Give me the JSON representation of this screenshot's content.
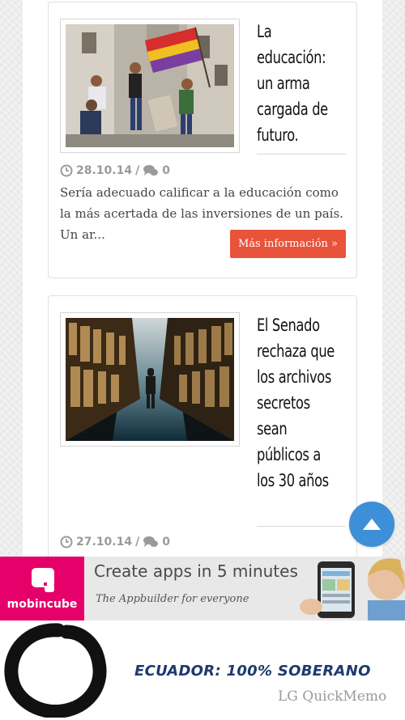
{
  "articles": [
    {
      "title": "La educación: un arma cargada de futuro.",
      "date": "28.10.14",
      "comments": "0",
      "excerpt": "Sería adecuado calificar a la educación como la más acertada de las inversiones de un país. Un ar...",
      "more_label": "Más información »"
    },
    {
      "title": "El Senado rechaza que los archivos secretos sean públicos a los 30 años",
      "date": "27.10.14",
      "comments": "0"
    }
  ],
  "meta_separator": "/",
  "ad": {
    "brand": "mobincube",
    "headline": "Create apps in 5 minutes",
    "subline": "The Appbuilder for everyone",
    "brand_color": "#e5006a"
  },
  "footer": {
    "title": "ECUADOR: 100% SOBERANO",
    "watermark": "LG QuickMemo"
  },
  "colors": {
    "accent_button": "#e8533a",
    "fab": "#3d8fd8"
  }
}
